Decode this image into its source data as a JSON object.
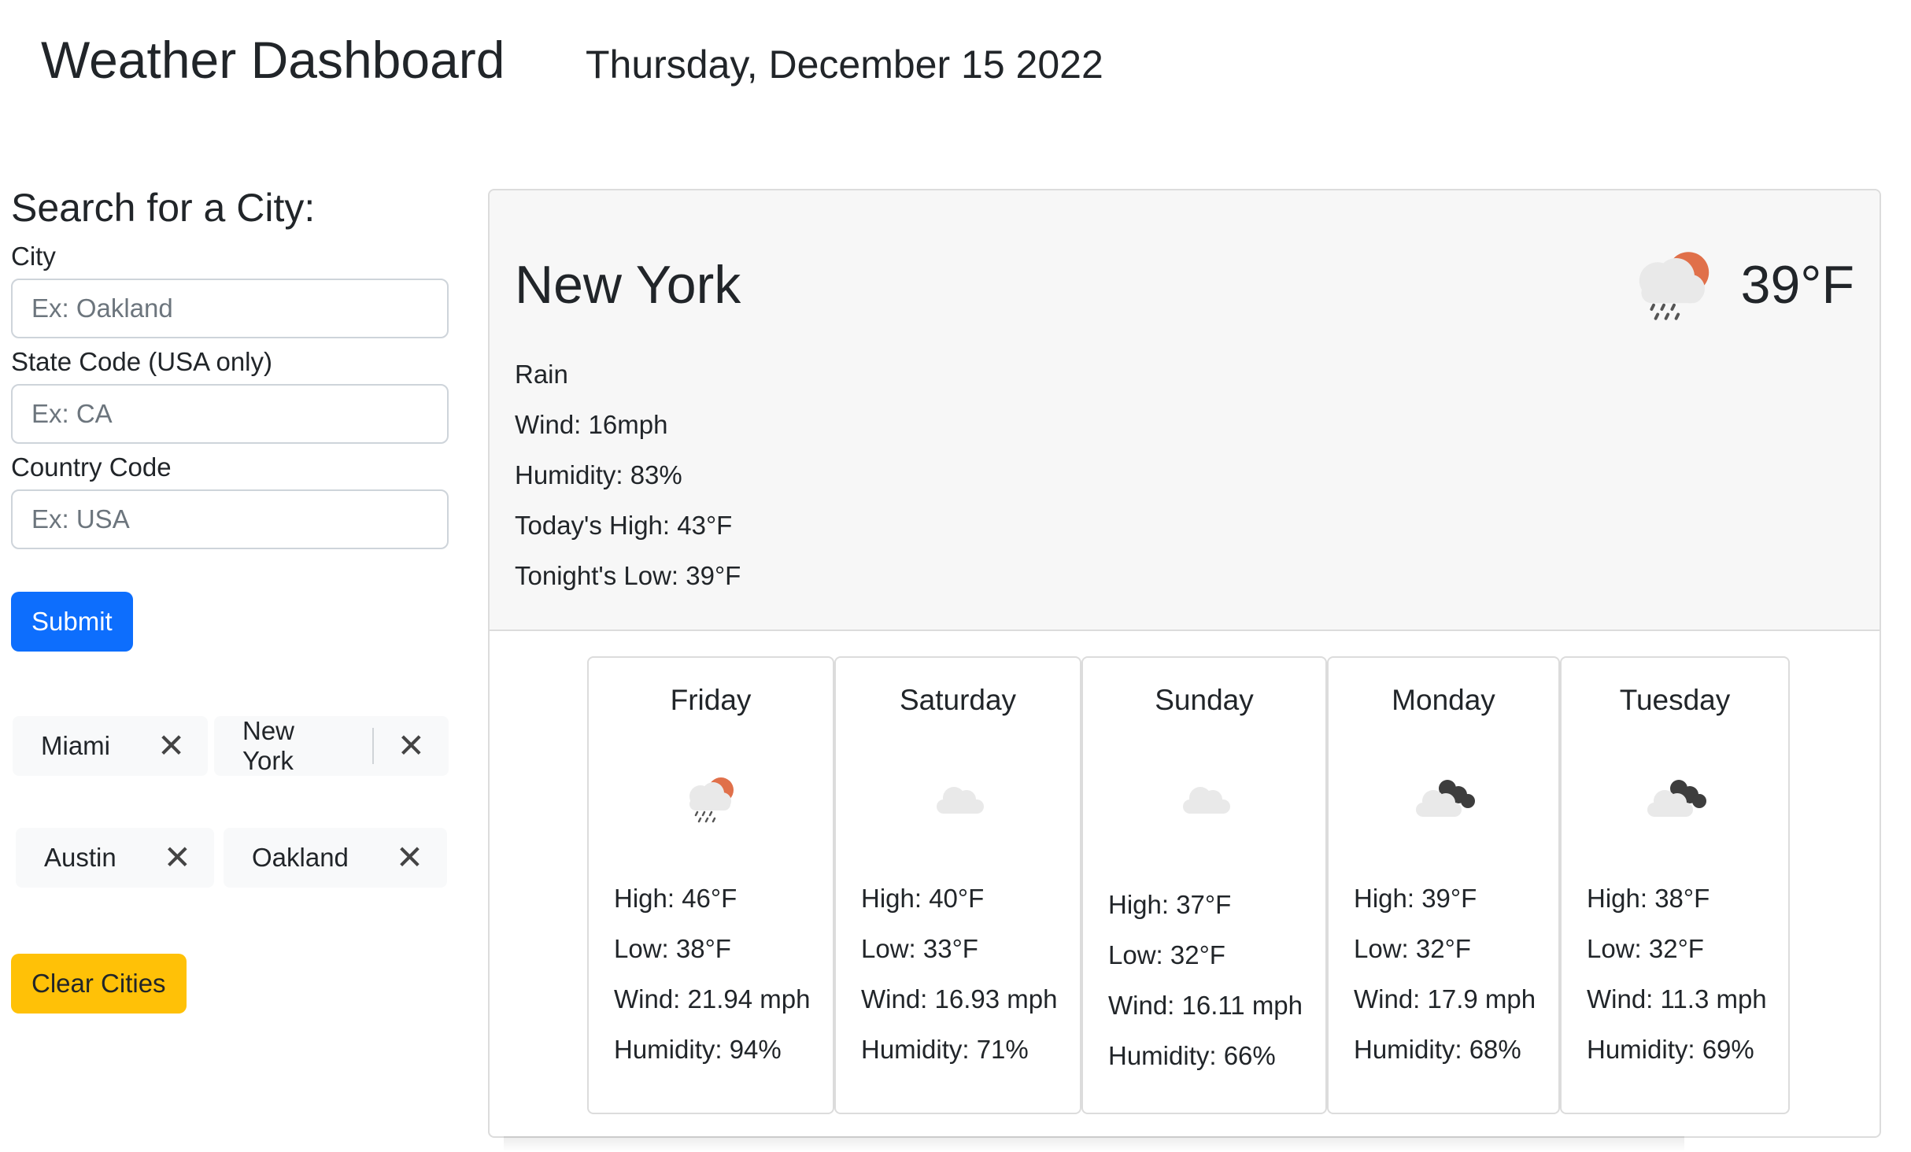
{
  "header": {
    "title": "Weather Dashboard",
    "date": "Thursday, December 15 2022"
  },
  "search": {
    "heading": "Search for a City:",
    "city_label": "City",
    "city_placeholder": "Ex: Oakland",
    "city_value": "",
    "state_label": "State Code (USA only)",
    "state_placeholder": "Ex: CA",
    "state_value": "",
    "country_label": "Country Code",
    "country_placeholder": "Ex: USA",
    "country_value": "",
    "submit_label": "Submit"
  },
  "saved_cities": [
    {
      "name": "Miami",
      "close_icon": "close-icon"
    },
    {
      "name": "New York",
      "close_icon": "close-icon"
    },
    {
      "name": "Austin",
      "close_icon": "close-icon"
    },
    {
      "name": "Oakland",
      "close_icon": "close-icon"
    }
  ],
  "close_glyph": "✕",
  "clear_label": "Clear Cities",
  "current": {
    "city": "New York",
    "temp": "39°F",
    "icon": "rain-partly-sunny-icon",
    "condition": "Rain",
    "wind": "Wind: 16mph",
    "humidity": "Humidity: 83%",
    "high": "Today's High: 43°F",
    "low": "Tonight's Low: 39°F"
  },
  "forecast": [
    {
      "day": "Friday",
      "icon": "rain-partly-sunny-icon",
      "high": "High: 46°F",
      "low": "Low: 38°F",
      "wind": "Wind: 21.94 mph",
      "humidity": "Humidity: 94%"
    },
    {
      "day": "Saturday",
      "icon": "cloud-icon",
      "high": "High: 40°F",
      "low": "Low: 33°F",
      "wind": "Wind: 16.93 mph",
      "humidity": "Humidity: 71%"
    },
    {
      "day": "Sunday",
      "icon": "cloud-icon",
      "high": "High: 37°F",
      "low": "Low: 32°F",
      "wind": "Wind: 16.11 mph",
      "humidity": "Humidity: 66%"
    },
    {
      "day": "Monday",
      "icon": "broken-clouds-icon",
      "high": "High: 39°F",
      "low": "Low: 32°F",
      "wind": "Wind: 17.9 mph",
      "humidity": "Humidity: 68%"
    },
    {
      "day": "Tuesday",
      "icon": "broken-clouds-icon",
      "high": "High: 38°F",
      "low": "Low: 32°F",
      "wind": "Wind: 11.3 mph",
      "humidity": "Humidity: 69%"
    }
  ],
  "colors": {
    "primary": "#0d6efd",
    "warning": "#ffc107",
    "sun": "#e0704a",
    "cloud_light": "#e9e9e9",
    "cloud_dark": "#3d3d3d"
  }
}
